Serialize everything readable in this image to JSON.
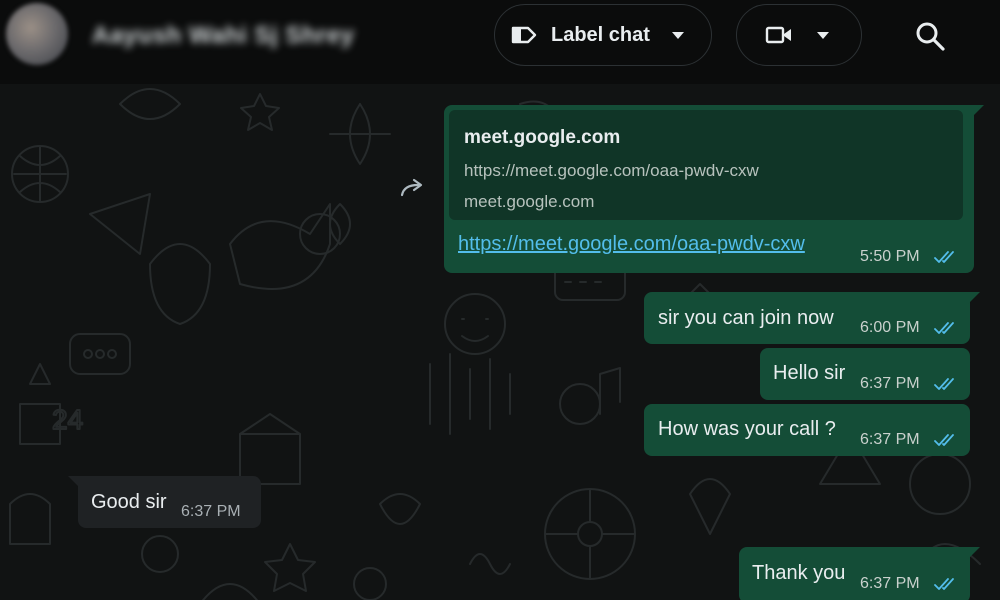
{
  "header": {
    "contact_name": "Aayush Wahi Sj Shrey",
    "label_button": "Label chat",
    "icons": {
      "avatar": "contact-avatar",
      "label": "label-tag-icon",
      "label_dropdown": "chevron-down-icon",
      "video": "video-camera-icon",
      "video_dropdown": "chevron-down-icon",
      "search": "search-icon"
    }
  },
  "messages": [
    {
      "direction": "outgoing",
      "link_preview": {
        "title": "meet.google.com",
        "url": "https://meet.google.com/oaa-pwdv-cxw",
        "domain": "meet.google.com"
      },
      "text": "https://meet.google.com/oaa-pwdv-cxw",
      "time": "5:50 PM",
      "status": "read"
    },
    {
      "direction": "outgoing",
      "text": "sir you can join now",
      "time": "6:00 PM",
      "status": "read"
    },
    {
      "direction": "outgoing",
      "text": "Hello sir",
      "time": "6:37 PM",
      "status": "read"
    },
    {
      "direction": "outgoing",
      "text": "How was your call ?",
      "time": "6:37 PM",
      "status": "read"
    },
    {
      "direction": "incoming",
      "text": "Good sir",
      "time": "6:37 PM"
    },
    {
      "direction": "outgoing",
      "text": "Thank you",
      "time": "6:37 PM",
      "status": "read"
    }
  ],
  "colors": {
    "outgoing_bubble": "#144d37",
    "incoming_bubble": "#1f2224",
    "link": "#53bdeb",
    "read_ticks": "#53bdeb",
    "background": "#111313"
  }
}
